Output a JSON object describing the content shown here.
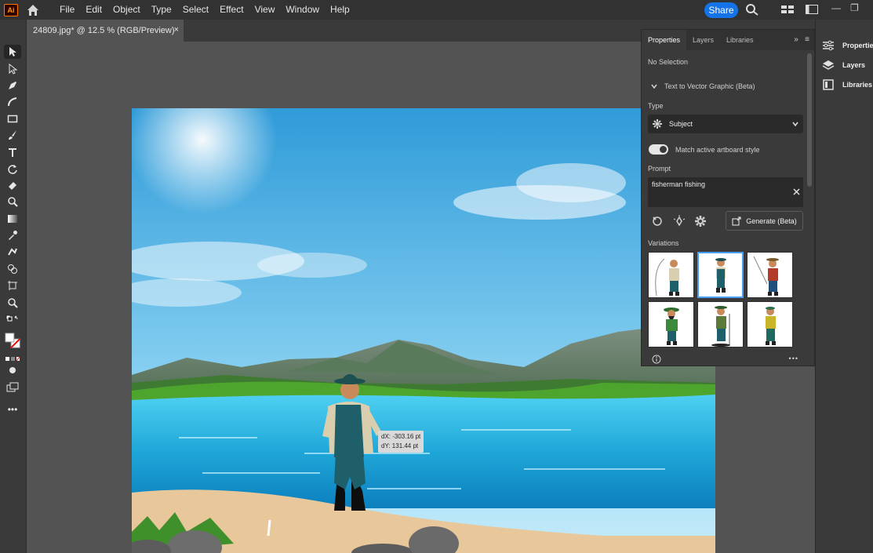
{
  "app": {
    "logo_text": "Ai"
  },
  "menu": [
    "File",
    "Edit",
    "Object",
    "Type",
    "Select",
    "Effect",
    "View",
    "Window",
    "Help"
  ],
  "share_label": "Share",
  "document_tab": {
    "title": "24809.jpg* @ 12.5 % (RGB/Preview)",
    "close": "×"
  },
  "window_controls": {
    "minimize": "—",
    "restore": "❐"
  },
  "panel": {
    "tabs": [
      "Properties",
      "Layers",
      "Libraries"
    ],
    "expand": "»",
    "menu": "≡",
    "selection_status": "No Selection",
    "section_title": "Text to Vector Graphic (Beta)",
    "type_label": "Type",
    "type_value": "Subject",
    "toggle_label": "Match active artboard style",
    "toggle_on": true,
    "prompt_label": "Prompt",
    "prompt_value": "fisherman fishing",
    "generate_label": "Generate (Beta)",
    "variations_label": "Variations",
    "more": "•••"
  },
  "dock": {
    "items": [
      "Properties",
      "Layers",
      "Libraries"
    ]
  },
  "tooltip": {
    "dx": "dX: -303.16 pt",
    "dy": "dY: 131.44 pt"
  },
  "colors": {
    "accent": "#1473e6",
    "selection": "#4b9cf5",
    "sky_top": "#2f9bd8",
    "water": "#1fa7d8",
    "sand": "#e8c79a"
  }
}
